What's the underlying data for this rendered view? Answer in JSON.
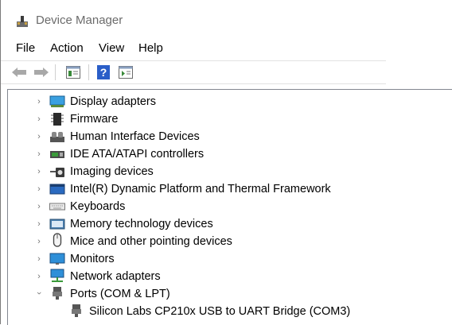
{
  "window": {
    "title": "Device Manager"
  },
  "menu": [
    "File",
    "Action",
    "View",
    "Help"
  ],
  "toolbar": {
    "buttons": [
      {
        "name": "back-arrow-icon"
      },
      {
        "name": "forward-arrow-icon"
      },
      {
        "name": "properties-icon"
      },
      {
        "name": "help-icon",
        "glyph": "?"
      },
      {
        "name": "update-driver-icon"
      }
    ]
  },
  "tree": [
    {
      "label": "Display adapters",
      "icon": "display-adapter-icon",
      "expanded": false
    },
    {
      "label": "Firmware",
      "icon": "firmware-icon",
      "expanded": false
    },
    {
      "label": "Human Interface Devices",
      "icon": "hid-icon",
      "expanded": false
    },
    {
      "label": "IDE ATA/ATAPI controllers",
      "icon": "ide-controller-icon",
      "expanded": false
    },
    {
      "label": "Imaging devices",
      "icon": "camera-icon",
      "expanded": false
    },
    {
      "label": "Intel(R) Dynamic Platform and Thermal Framework",
      "icon": "intel-framework-icon",
      "expanded": false
    },
    {
      "label": "Keyboards",
      "icon": "keyboard-icon",
      "expanded": false
    },
    {
      "label": "Memory technology devices",
      "icon": "memory-icon",
      "expanded": false
    },
    {
      "label": "Mice and other pointing devices",
      "icon": "mouse-icon",
      "expanded": false
    },
    {
      "label": "Monitors",
      "icon": "monitor-icon",
      "expanded": false
    },
    {
      "label": "Network adapters",
      "icon": "network-adapter-icon",
      "expanded": false
    },
    {
      "label": "Ports (COM & LPT)",
      "icon": "port-icon",
      "expanded": true
    },
    {
      "label": "Silicon Labs CP210x USB to UART Bridge (COM3)",
      "icon": "port-icon",
      "child": true
    }
  ]
}
